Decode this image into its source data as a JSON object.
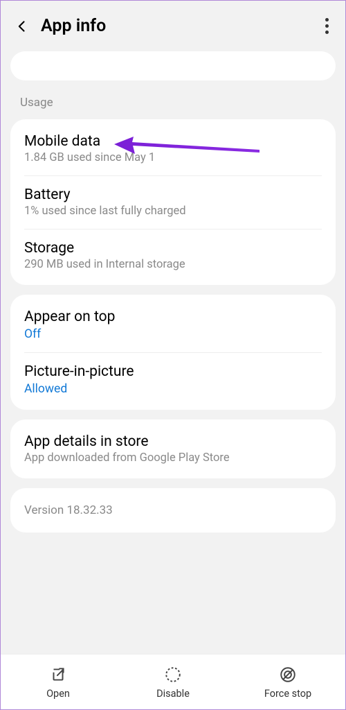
{
  "header": {
    "title": "App info"
  },
  "section_label": "Usage",
  "usage_card": {
    "mobile_data": {
      "title": "Mobile data",
      "sub": "1.84 GB used since May 1"
    },
    "battery": {
      "title": "Battery",
      "sub": "1% used since last fully charged"
    },
    "storage": {
      "title": "Storage",
      "sub": "290 MB used in Internal storage"
    }
  },
  "display_card": {
    "appear_on_top": {
      "title": "Appear on top",
      "value": "Off"
    },
    "pip": {
      "title": "Picture-in-picture",
      "value": "Allowed"
    }
  },
  "store_card": {
    "title": "App details in store",
    "sub": "App downloaded from Google Play Store"
  },
  "version": "Version 18.32.33",
  "bottom": {
    "open": "Open",
    "disable": "Disable",
    "force_stop": "Force stop"
  }
}
